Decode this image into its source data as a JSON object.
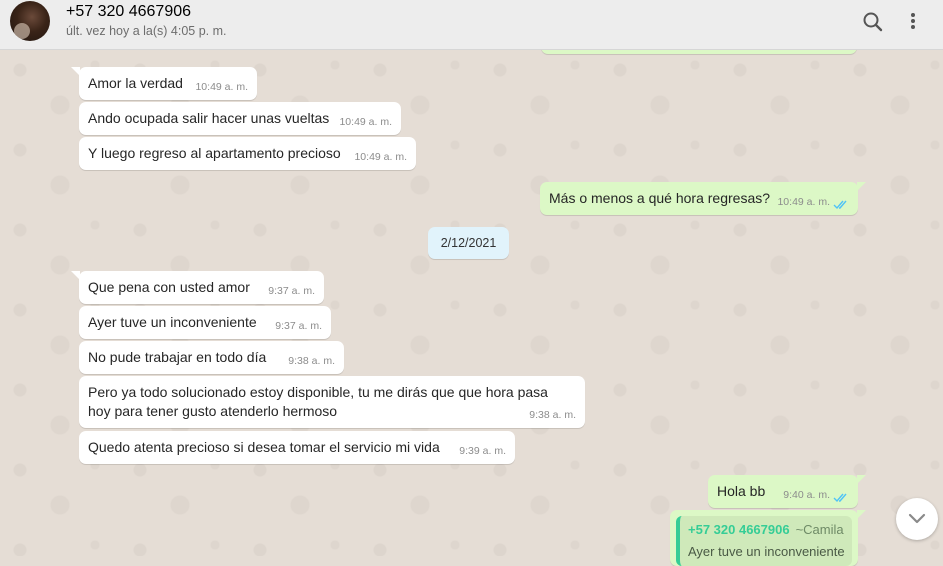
{
  "header": {
    "contact_name": "+57 320 4667906",
    "last_seen": "últ. vez hoy a la(s) 4:05 p. m.",
    "icons": [
      "search-icon",
      "menu-icon"
    ]
  },
  "colors": {
    "incoming_bubble": "#ffffff",
    "outgoing_bubble": "#dcf8c6",
    "date_pill": "#e1f3fb",
    "read_ticks": "#4fc3f7",
    "quote_accent": "#35cd96"
  },
  "messages": [
    {
      "text": "Amor la verdad",
      "time": "10:49 a. m."
    },
    {
      "text": "Ando ocupada salir hacer unas vueltas",
      "time": "10:49 a. m."
    },
    {
      "text": "Y luego regreso al apartamento precioso",
      "time": "10:49 a. m."
    },
    {
      "text": "Más o menos a qué hora regresas?",
      "time": "10:49 a. m."
    },
    {
      "text": "Que pena con usted amor",
      "time": "9:37 a. m."
    },
    {
      "text": "Ayer tuve un inconveniente",
      "time": "9:37 a. m."
    },
    {
      "text": "No pude trabajar en todo día",
      "time": "9:38 a. m."
    },
    {
      "text": "Pero ya todo solucionado estoy disponible, tu me dirás que que hora pasa hoy para tener gusto atenderlo hermoso",
      "time": "9:38 a. m."
    },
    {
      "text": "Quedo atenta precioso si desea tomar el servicio mi vida",
      "time": "9:39 a. m."
    },
    {
      "text": "Hola bb",
      "time": "9:40 a. m."
    }
  ],
  "date_separator": "2/12/2021",
  "quoted_reply": {
    "author": "+57 320 4667906",
    "alias": "~Camila",
    "text": "Ayer tuve un inconveniente"
  }
}
